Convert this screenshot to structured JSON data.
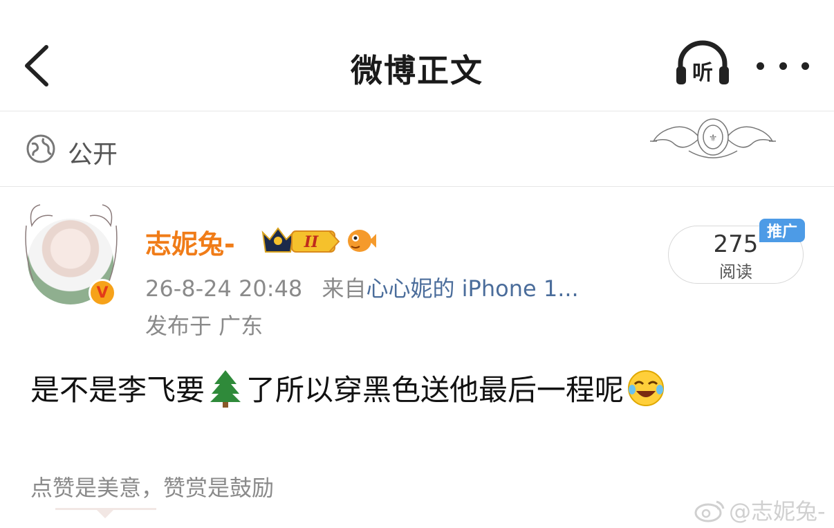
{
  "nav": {
    "title": "微博正文",
    "listen_label": "听"
  },
  "visibility": {
    "label": "公开"
  },
  "author": {
    "name": "志妮兔-",
    "level_badge": "II",
    "verified_mark": "V"
  },
  "meta": {
    "datetime": "26-8-24 20:48",
    "from_prefix": "来自",
    "source": "心心妮的 iPhone 1...",
    "location": "发布于 广东"
  },
  "read_count": {
    "value": "275",
    "label": "阅读",
    "promo_tag": "推广"
  },
  "post": {
    "text_part1": "是不是李飞要",
    "text_part2": "了所以穿黑色送他最后一程呢"
  },
  "like_tip": "点赞是美意，赞赏是鼓励",
  "watermark": "@志妮兔-",
  "icons": [
    "back-arrow-icon",
    "headphones-icon",
    "more-dots-icon",
    "globe-icon",
    "crown-icon",
    "fish-icon",
    "tree-emoji",
    "laughing-emoji",
    "weibo-logo-icon"
  ],
  "colors": {
    "username": "#f07c18",
    "source_link": "#4b6d9b",
    "promo": "#4d9be6",
    "meta": "#8a8a8a"
  }
}
